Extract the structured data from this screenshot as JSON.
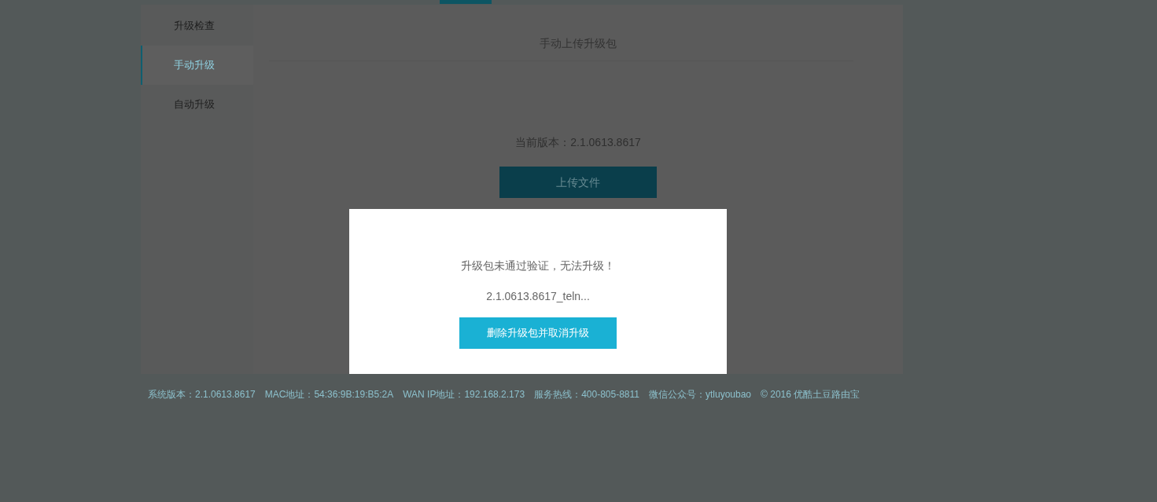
{
  "sidebar": {
    "items": [
      {
        "label": "升级检查",
        "selected": false
      },
      {
        "label": "手动升级",
        "selected": true
      },
      {
        "label": "自动升级",
        "selected": false
      }
    ]
  },
  "main": {
    "title": "手动上传升级包",
    "current_version": "当前版本：2.1.0613.8617",
    "upload_button": "上传文件"
  },
  "dialog": {
    "message": "升级包未通过验证，无法升级！",
    "file_name": "2.1.0613.8617_teln...",
    "button": "删除升级包并取消升级"
  },
  "footer": {
    "items": [
      "系统版本：2.1.0613.8617",
      "MAC地址：54:36:9B:19:B5:2A",
      "WAN IP地址：192.168.2.173",
      "服务热线：400-805-8811",
      "微信公众号：ytluyoubao",
      "© 2016 优酷土豆路由宝"
    ]
  }
}
